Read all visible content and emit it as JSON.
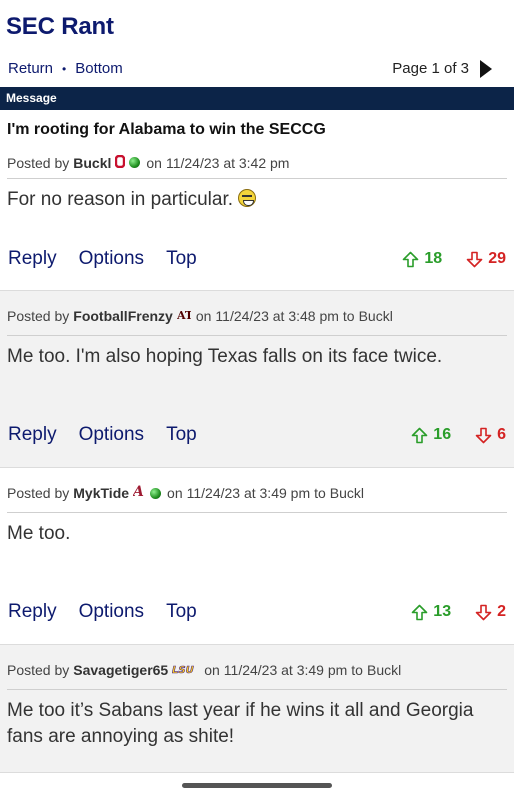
{
  "site": {
    "title": "SEC Rant"
  },
  "nav": {
    "return_label": "Return",
    "separator": "•",
    "bottom_label": "Bottom",
    "page_label": "Page 1 of 3"
  },
  "message_bar": {
    "label": "Message"
  },
  "thread": {
    "title": "I'm rooting for Alabama to win the SECCG"
  },
  "labels": {
    "posted_by": "Posted by",
    "on": "on",
    "to": "to",
    "reply": "Reply",
    "options": "Options",
    "top": "Top"
  },
  "posts": [
    {
      "user": "Buckl",
      "flair": "ohio-state-logo",
      "online": true,
      "date": "11/24/23 at 3:42 pm",
      "reply_to": "",
      "body": "For no reason in particular.",
      "emoji": "grimace-emoji",
      "upvotes": "18",
      "downvotes": "29"
    },
    {
      "user": "FootballFrenzy",
      "flair": "texas-am-logo",
      "online": false,
      "date": "11/24/23 at 3:48 pm",
      "reply_to": "Buckl",
      "body": "Me too. I'm also hoping Texas falls on its face twice.",
      "upvotes": "16",
      "downvotes": "6"
    },
    {
      "user": "MykTide",
      "flair": "alabama-logo",
      "online": true,
      "date": "11/24/23 at 3:49 pm",
      "reply_to": "Buckl",
      "body": "Me too.",
      "upvotes": "13",
      "downvotes": "2"
    },
    {
      "user": "Savagetiger65",
      "flair": "lsu-logo",
      "online": false,
      "date": "11/24/23 at 3:49 pm",
      "reply_to": "Buckl",
      "body": "Me too it’s Sabans last year if he wins it all and Georgia fans are annoying as shite!"
    }
  ],
  "colors": {
    "brand": "#0d1a6e",
    "bar": "#0c2448",
    "up": "#2a9d2a",
    "down": "#d42323"
  },
  "icons": {
    "pager": "play-arrow-icon",
    "upvote": "arrow-up-icon",
    "downvote": "arrow-down-icon",
    "online": "online-status-icon"
  }
}
